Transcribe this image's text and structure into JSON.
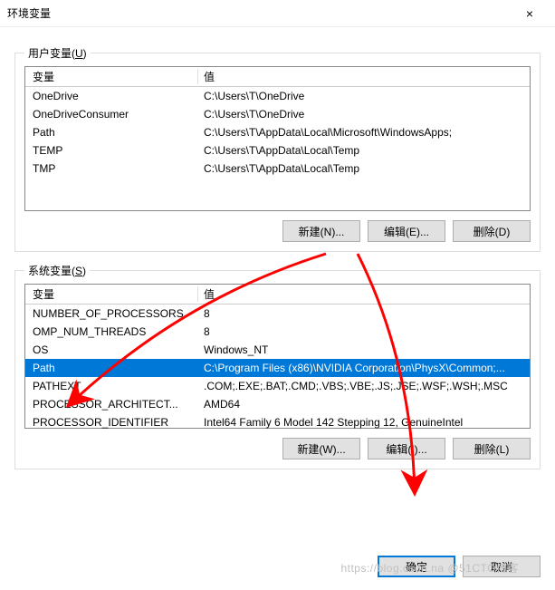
{
  "window": {
    "title": "环境变量",
    "close_label": "×"
  },
  "user_section": {
    "legend_prefix": "用户变量(",
    "legend_key": "U",
    "legend_suffix": ")",
    "col_name": "变量",
    "col_value": "值",
    "rows": [
      {
        "name": "OneDrive",
        "value": "C:\\Users\\T\\OneDrive"
      },
      {
        "name": "OneDriveConsumer",
        "value": "C:\\Users\\T\\OneDrive"
      },
      {
        "name": "Path",
        "value": "C:\\Users\\T\\AppData\\Local\\Microsoft\\WindowsApps;"
      },
      {
        "name": "TEMP",
        "value": "C:\\Users\\T\\AppData\\Local\\Temp"
      },
      {
        "name": "TMP",
        "value": "C:\\Users\\T\\AppData\\Local\\Temp"
      }
    ],
    "buttons": {
      "new": "新建(N)...",
      "edit": "编辑(E)...",
      "delete": "删除(D)"
    }
  },
  "system_section": {
    "legend_prefix": "系统变量(",
    "legend_key": "S",
    "legend_suffix": ")",
    "col_name": "变量",
    "col_value": "值",
    "selected_index": 3,
    "rows": [
      {
        "name": "NUMBER_OF_PROCESSORS",
        "value": "8"
      },
      {
        "name": "OMP_NUM_THREADS",
        "value": "8"
      },
      {
        "name": "OS",
        "value": "Windows_NT"
      },
      {
        "name": "Path",
        "value": "C:\\Program Files (x86)\\NVIDIA Corporation\\PhysX\\Common;..."
      },
      {
        "name": "PATHEXT",
        "value": ".COM;.EXE;.BAT;.CMD;.VBS;.VBE;.JS;.JSE;.WSF;.WSH;.MSC"
      },
      {
        "name": "PROCESSOR_ARCHITECT...",
        "value": "AMD64"
      },
      {
        "name": "PROCESSOR_IDENTIFIER",
        "value": "Intel64 Family 6 Model 142 Stepping 12, GenuineIntel"
      }
    ],
    "buttons": {
      "new": "新建(W)...",
      "edit": "编辑(I)...",
      "delete": "删除(L)"
    }
  },
  "dialog_buttons": {
    "ok": "确定",
    "cancel": "取消"
  },
  "watermark": "https://blog.csdn.na @51CTO博客",
  "annotation": {
    "color": "#ff0000"
  }
}
